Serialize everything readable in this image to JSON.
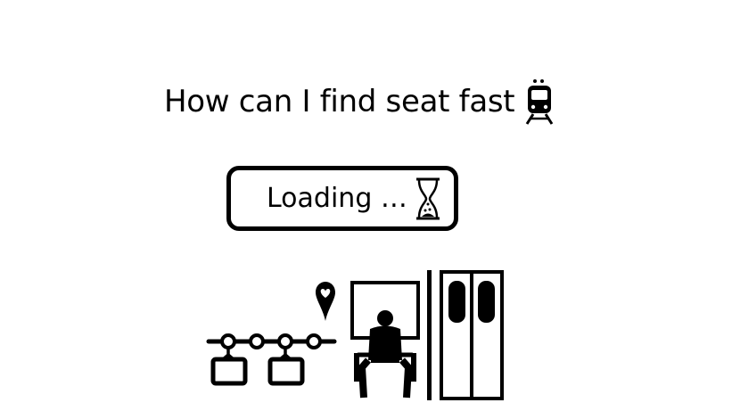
{
  "header": {
    "title": "How can I find seat fast",
    "title_icon": "train-icon"
  },
  "status": {
    "loading_label": "Loading …",
    "loading_icon": "hourglass-icon"
  },
  "illustration": {
    "icons": [
      "hand-straps-icon",
      "heart-location-pin-icon",
      "seated-passenger-icon",
      "train-doors-icon"
    ]
  },
  "colors": {
    "foreground": "#000000",
    "background": "#ffffff"
  }
}
